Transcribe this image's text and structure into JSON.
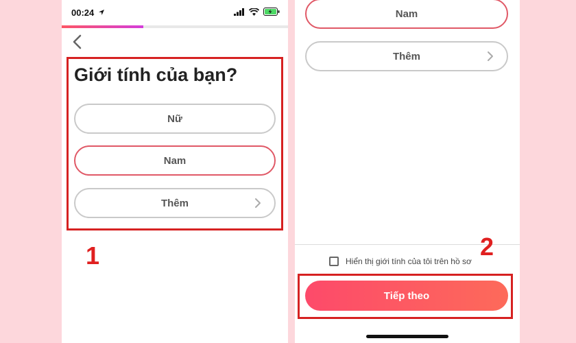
{
  "left_screen": {
    "status_time": "00:24",
    "progress": 0.36,
    "title": "Giới tính của bạn?",
    "options": [
      {
        "label": "Nữ",
        "selected": false
      },
      {
        "label": "Nam",
        "selected": true
      },
      {
        "label": "Thêm",
        "selected": false,
        "has_chevron": true
      }
    ],
    "annotation_number": "1"
  },
  "right_screen": {
    "options": [
      {
        "label": "Nam",
        "selected": true
      },
      {
        "label": "Thêm",
        "selected": false,
        "has_chevron": true
      }
    ],
    "show_gender_label": "Hiển thị giới tính của tôi trên hồ sơ",
    "show_gender_checked": false,
    "continue_label": "Tiếp theo",
    "annotation_number": "2"
  },
  "colors": {
    "background": "#fdd7dc",
    "accent": "#fd5564",
    "annotation_red": "#d62121",
    "selected_border": "#e05866"
  },
  "icons": [
    "location-arrow-icon",
    "signal-icon",
    "wifi-icon",
    "battery-charging-icon",
    "chevron-left-icon",
    "chevron-right-icon",
    "checkbox-icon"
  ]
}
